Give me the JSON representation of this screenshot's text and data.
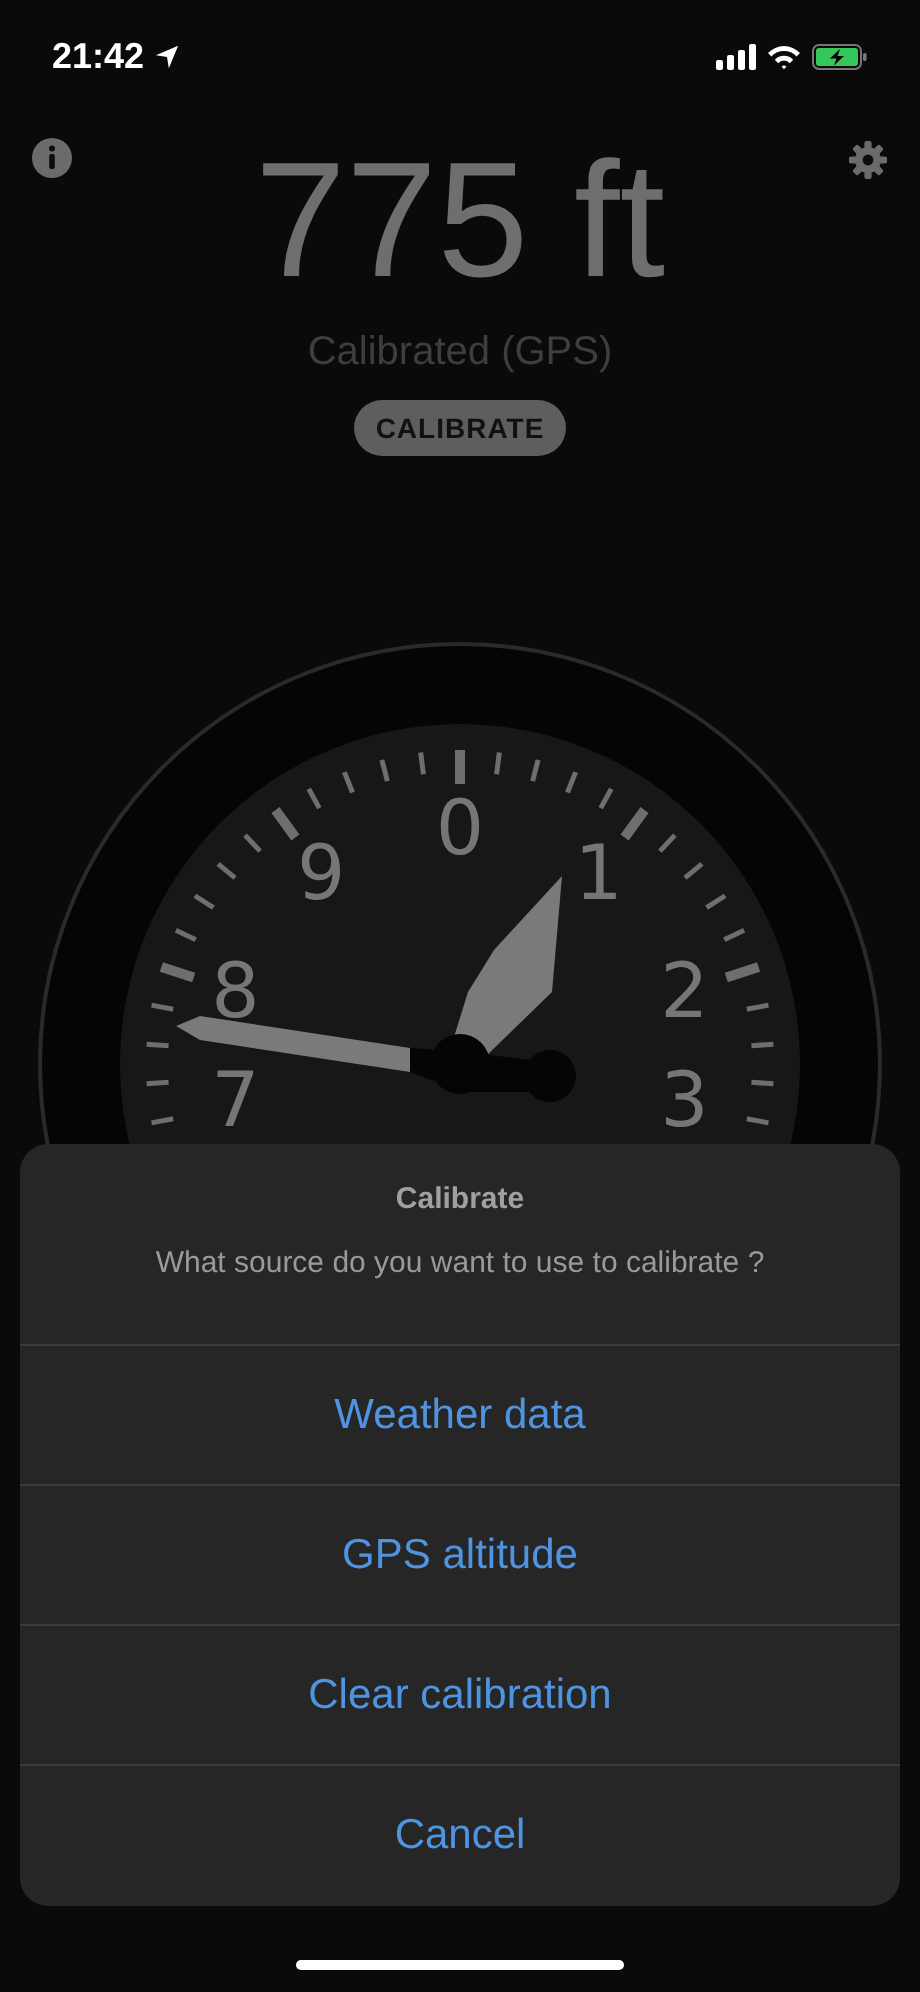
{
  "status_bar": {
    "time": "21:42"
  },
  "altitude": "775 ft",
  "calibration_status": "Calibrated (GPS)",
  "calibrate_button": "CALIBRATE",
  "gauge": {
    "dial_numbers": [
      "0",
      "1",
      "2",
      "3",
      "7",
      "8",
      "9"
    ]
  },
  "action_sheet": {
    "title": "Calibrate",
    "message": "What source do you want to use to calibrate ?",
    "actions": [
      {
        "label": "Weather data"
      },
      {
        "label": "GPS altitude"
      },
      {
        "label": "Clear calibration"
      },
      {
        "label": "Cancel"
      }
    ]
  }
}
